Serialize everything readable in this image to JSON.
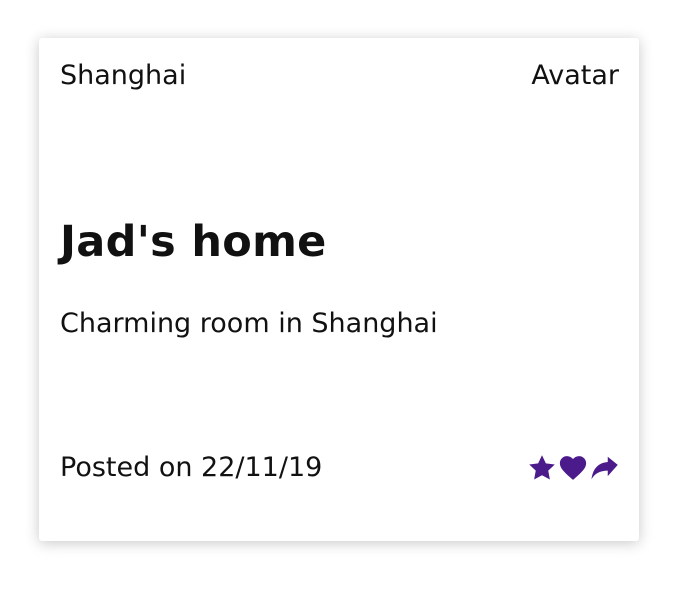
{
  "card": {
    "city": "Shanghai",
    "avatar_label": "Avatar",
    "title": "Jad's home",
    "description": "Charming room in Shanghai",
    "posted": "Posted on 22/11/19",
    "actions": [
      {
        "icon": "star-icon"
      },
      {
        "icon": "heart-icon"
      },
      {
        "icon": "share-icon"
      }
    ]
  },
  "colors": {
    "icon_color": "#4b1b8c",
    "text_color": "#111111"
  }
}
